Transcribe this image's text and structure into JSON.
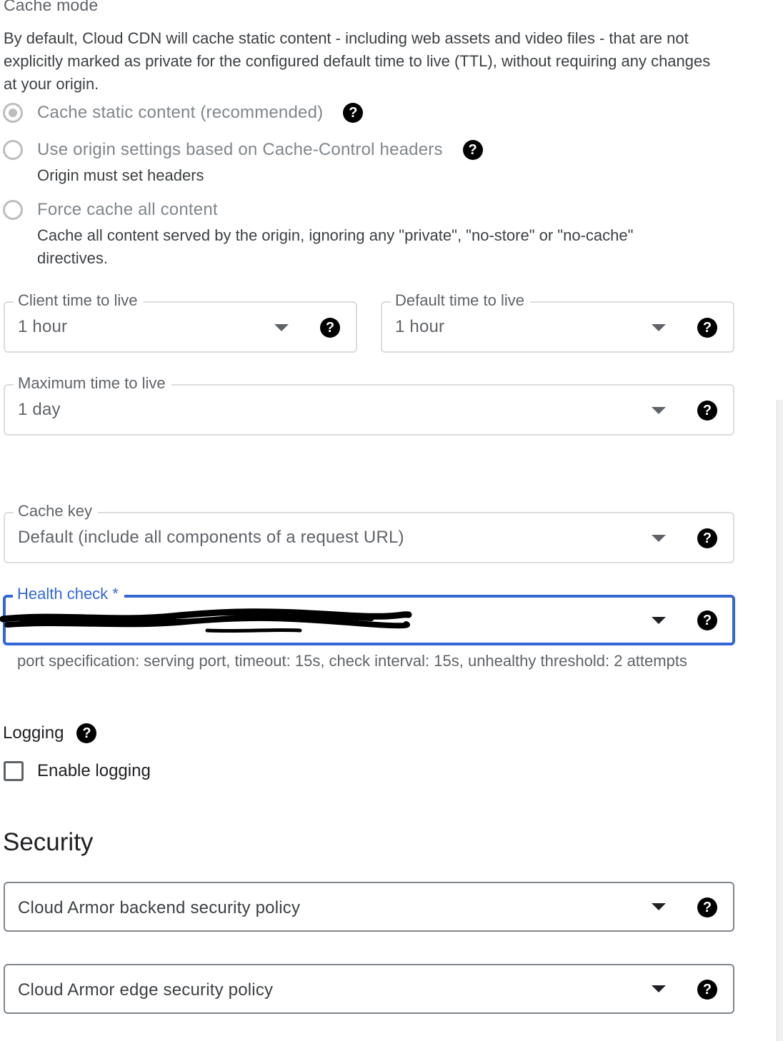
{
  "cache_mode": {
    "title": "Cache mode",
    "description": "By default, Cloud CDN will cache static content - including web assets and video files - that are not explicitly marked as private for the configured default time to live (TTL), without requiring any changes at your origin.",
    "options": [
      {
        "label": "Cache static content (recommended)",
        "checked": true
      },
      {
        "label": "Use origin settings based on Cache-Control headers",
        "sublabel": "Origin must set headers",
        "checked": false
      },
      {
        "label": "Force cache all content",
        "sublabel": "Cache all content served by the origin, ignoring any \"private\", \"no-store\" or \"no-cache\" directives.",
        "checked": false
      }
    ]
  },
  "client_ttl": {
    "label": "Client time to live",
    "value": "1 hour"
  },
  "default_ttl": {
    "label": "Default time to live",
    "value": "1 hour"
  },
  "max_ttl": {
    "label": "Maximum time to live",
    "value": "1 day"
  },
  "cache_key": {
    "label": "Cache key",
    "value": "Default (include all components of a request URL)"
  },
  "health_check": {
    "label": "Health check *",
    "helper": "port specification: serving port, timeout: 15s, check interval: 15s, unhealthy threshold: 2 attempts"
  },
  "logging": {
    "title": "Logging",
    "checkbox_label": "Enable logging",
    "checked": false
  },
  "security": {
    "title": "Security",
    "backend_policy": "Cloud Armor backend security policy",
    "edge_policy": "Cloud Armor edge security policy"
  },
  "help_glyph": "?",
  "colors": {
    "accent": "#3367d6",
    "border": "#dadce0"
  }
}
